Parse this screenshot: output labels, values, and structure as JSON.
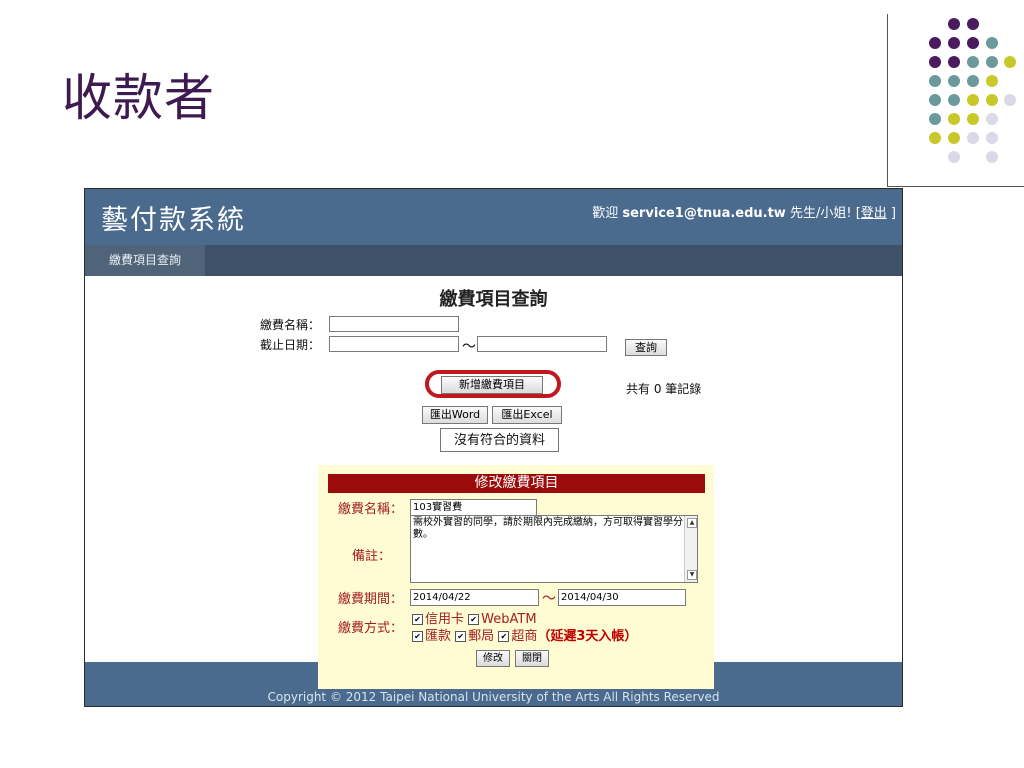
{
  "slide": {
    "title": "收款者",
    "dot_colors": {
      "purple": "#4b1a5f",
      "teal": "#6c9a9c",
      "lime": "#c8c82a",
      "lavender": "#d9d9e8"
    }
  },
  "app": {
    "title": "藝付款系統",
    "welcome_prefix": "歡迎",
    "user_email": "service1@tnua.edu.tw",
    "welcome_suffix": "先生/小姐! [",
    "logout": "登出",
    "welcome_close": "]",
    "menu_item": "繳費項目查詢",
    "header_color": "#4a6a8e",
    "menubar_color": "#3e5166"
  },
  "query": {
    "heading": "繳費項目查詢",
    "name_label": "繳費名稱：",
    "name_value": "",
    "date_label": "截止日期：",
    "date_from": "",
    "date_to": "",
    "tilde": "～",
    "search_button": "查詢",
    "add_button": "新增繳費項目",
    "record_count": "共有 0 筆記錄",
    "export_word": "匯出Word",
    "export_excel": "匯出Excel",
    "no_data": "沒有符合的資料"
  },
  "edit": {
    "title": "修改繳費項目",
    "name_label": "繳費名稱：",
    "name_value": "103實習費",
    "note_label": "備註：",
    "note_value": "需校外實習的同學，請於期限內完成繳納，方可取得實習學分數。",
    "period_label": "繳費期間：",
    "period_from": "2014/04/22",
    "period_tilde": "～",
    "period_to": "2014/04/30",
    "pay_label": "繳費方式：",
    "methods_row1": [
      "信用卡",
      "WebATM"
    ],
    "methods_row2": [
      "匯款",
      "郵局",
      "超商"
    ],
    "delay_note": "（延遲3天入帳）",
    "save_button": "修改",
    "close_button": "關閉",
    "highlight_color": "#c0181e"
  },
  "footer": {
    "copyright": "Copyright © 2012 Taipei National University of the Arts All Rights Reserved"
  }
}
